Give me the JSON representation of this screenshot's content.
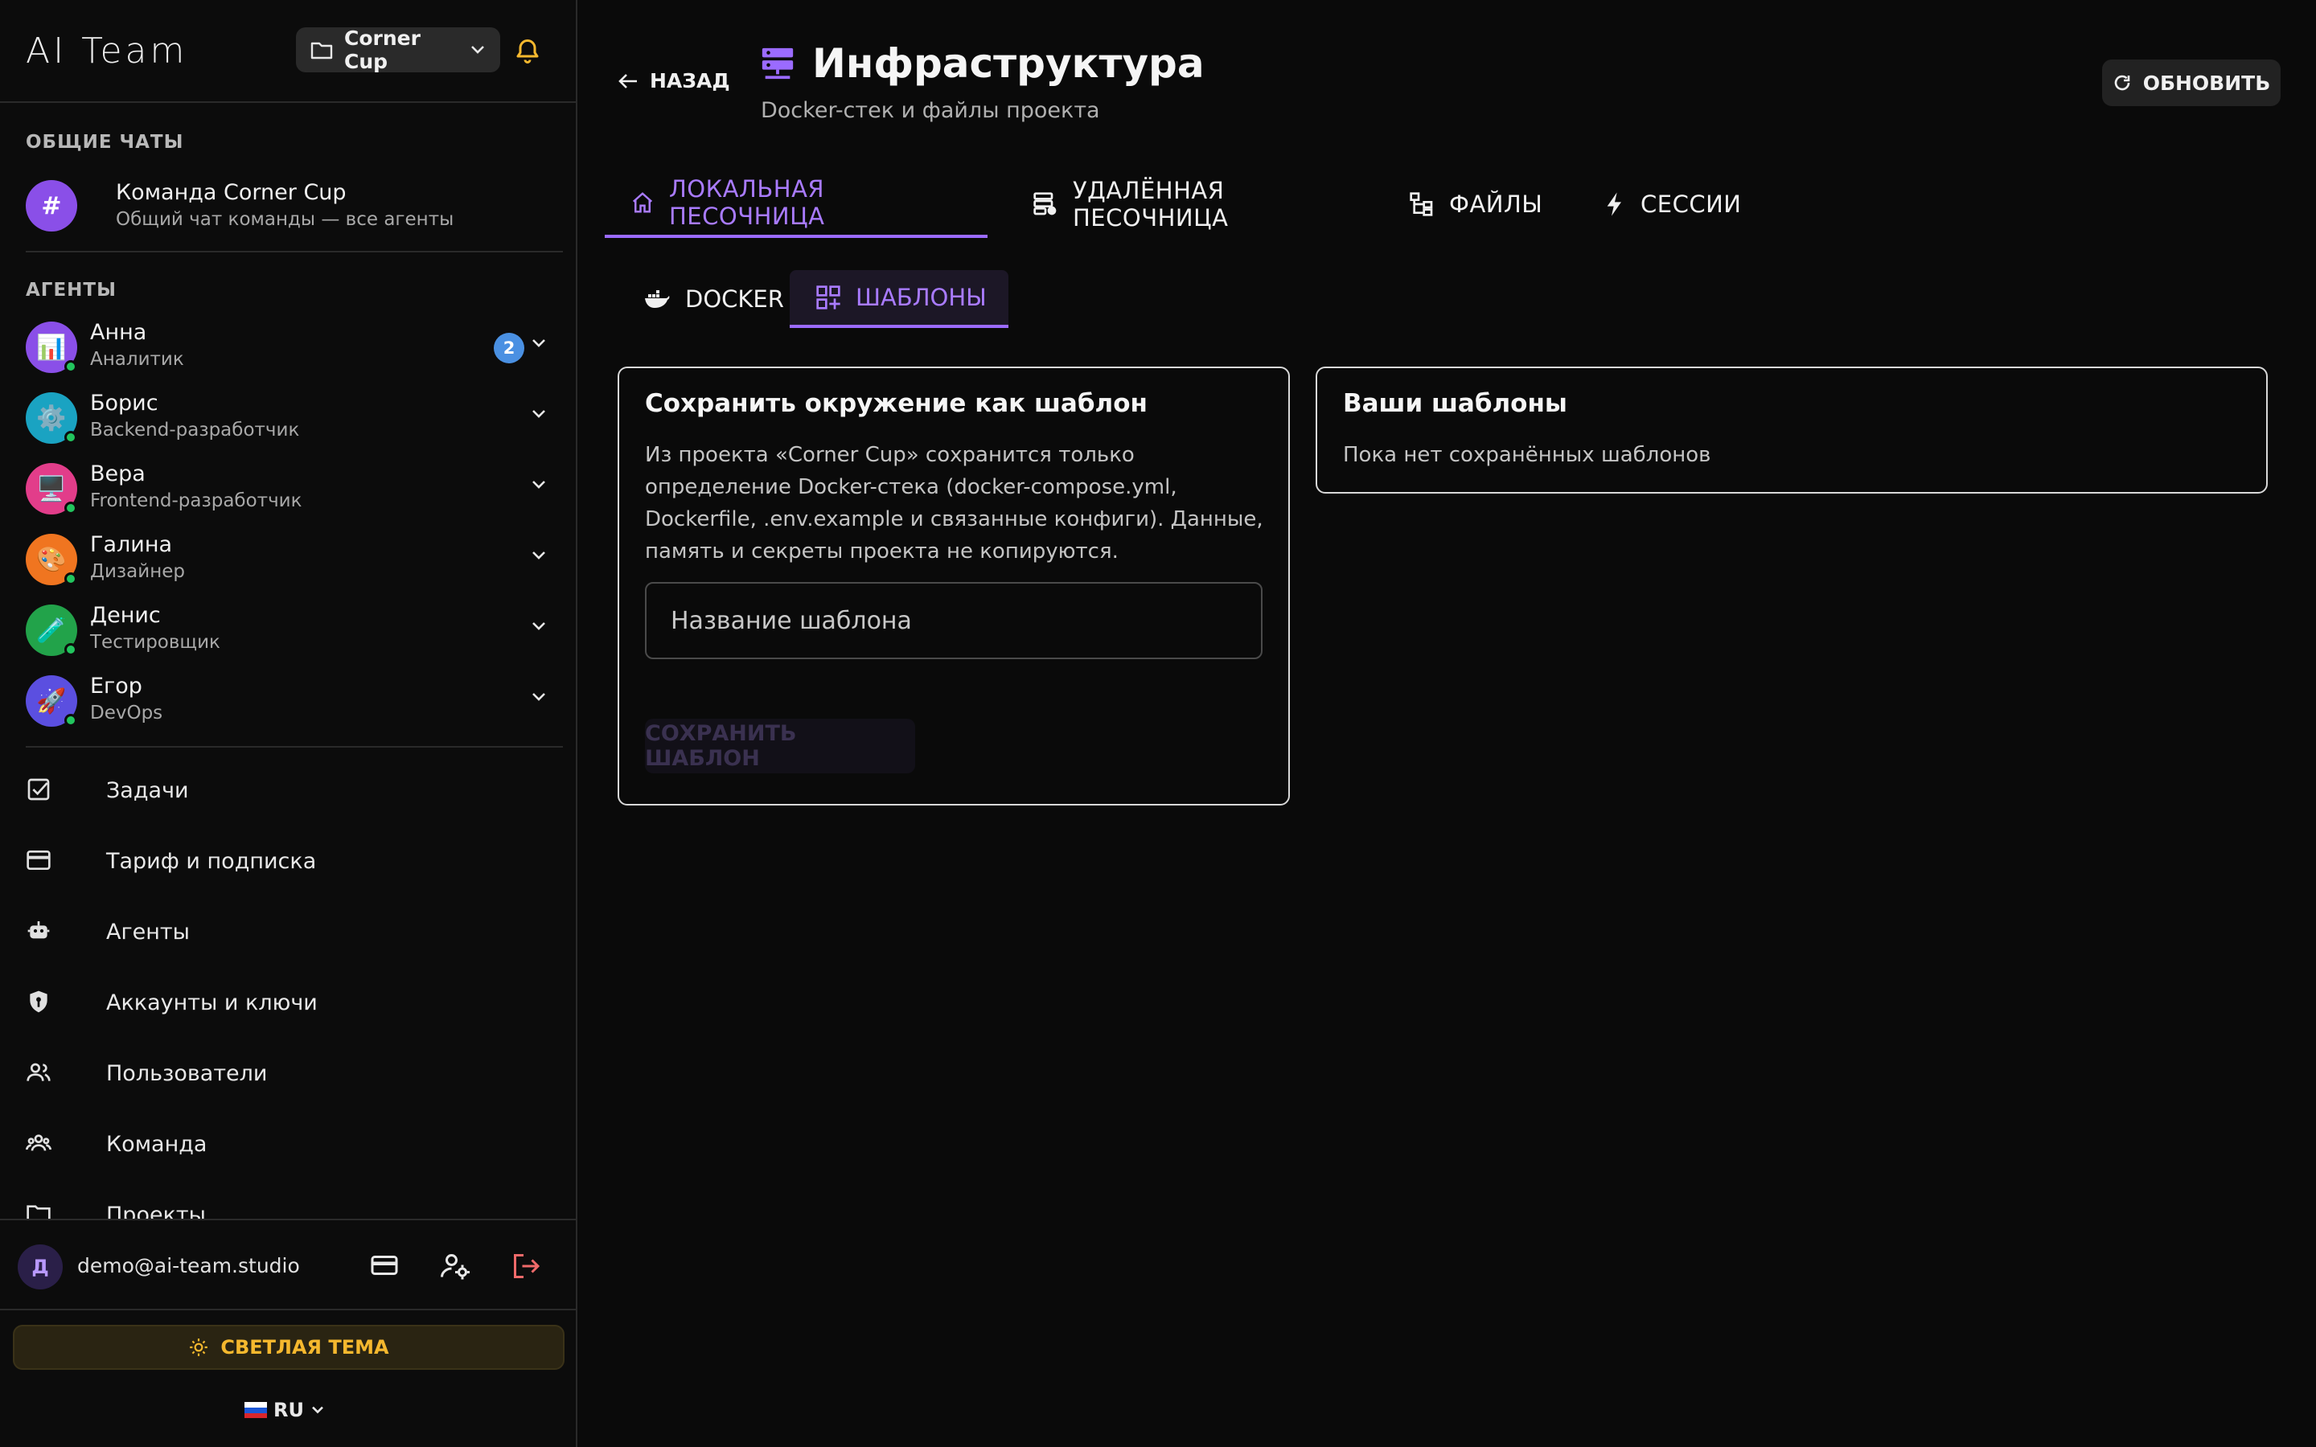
{
  "sidebar": {
    "app_title": "AI Team",
    "project_select": {
      "label": "Corner Cup"
    },
    "general_chats_title": "ОБЩИЕ ЧАТЫ",
    "team_chat": {
      "avatar": "#",
      "name": "Команда Corner Cup",
      "subtitle": "Общий чат команды — все агенты"
    },
    "agents_title": "АГЕНТЫ",
    "agents": [
      {
        "name": "Анна",
        "role": "Аналитик",
        "emoji": "📊",
        "color": "#8a4fe8",
        "badge": "2",
        "online": true
      },
      {
        "name": "Борис",
        "role": "Backend-разработчик",
        "emoji": "⚙️",
        "color": "#1aa3c2",
        "badge": "",
        "online": true
      },
      {
        "name": "Вера",
        "role": "Frontend-разработчик",
        "emoji": "🖥️",
        "color": "#e23d8a",
        "badge": "",
        "online": true
      },
      {
        "name": "Галина",
        "role": "Дизайнер",
        "emoji": "🎨",
        "color": "#f07520",
        "badge": "",
        "online": true
      },
      {
        "name": "Денис",
        "role": "Тестировщик",
        "emoji": "🧪",
        "color": "#22a34a",
        "badge": "",
        "online": true
      },
      {
        "name": "Егор",
        "role": "DevOps",
        "emoji": "🚀",
        "color": "#5b4fe0",
        "badge": "",
        "online": true
      }
    ],
    "nav": [
      {
        "label": "Задачи",
        "icon": "task-check-icon"
      },
      {
        "label": "Тариф и подписка",
        "icon": "credit-card-icon"
      },
      {
        "label": "Агенты",
        "icon": "robot-icon"
      },
      {
        "label": "Аккаунты и ключи",
        "icon": "shield-key-icon"
      },
      {
        "label": "Пользователи",
        "icon": "users-icon"
      },
      {
        "label": "Команда",
        "icon": "team-icon"
      },
      {
        "label": "Проекты",
        "icon": "folder-icon"
      }
    ],
    "user": {
      "initial": "Д",
      "email": "demo@ai-team.studio"
    },
    "theme_button": "СВЕТЛАЯ ТЕМА",
    "language": {
      "flag": "🇷🇺",
      "code": "RU"
    }
  },
  "header": {
    "back_label": "НАЗАД",
    "title": "Инфраструктура",
    "subtitle": "Docker-стек и файлы проекта",
    "refresh_label": "ОБНОВИТЬ"
  },
  "tabs": [
    {
      "label": "ЛОКАЛЬНАЯ ПЕСОЧНИЦА",
      "icon": "home-icon",
      "active": true
    },
    {
      "label": "УДАЛЁННАЯ ПЕСОЧНИЦА",
      "icon": "server-remote-icon",
      "active": false
    },
    {
      "label": "ФАЙЛЫ",
      "icon": "file-tree-icon",
      "active": false
    },
    {
      "label": "СЕССИИ",
      "icon": "bolt-icon",
      "active": false
    }
  ],
  "subtabs": [
    {
      "label": "DOCKER",
      "icon": "docker-icon",
      "active": false
    },
    {
      "label": "ШАБЛОНЫ",
      "icon": "templates-icon",
      "active": true
    }
  ],
  "save_card": {
    "title": "Сохранить окружение как шаблон",
    "description": "Из проекта «Corner Cup» сохранится только определение Docker-стека (docker-compose.yml, Dockerfile, .env.example и связанные конфиги). Данные, память и секреты проекта не копируются.",
    "input_placeholder": "Название шаблона",
    "input_value": "",
    "save_label": "СОХРАНИТЬ ШАБЛОН"
  },
  "templates_card": {
    "title": "Ваши шаблоны",
    "empty_text": "Пока нет сохранённых шаблонов"
  },
  "colors": {
    "accent": "#9b6bff",
    "warning": "#f5b82e",
    "badge": "#4a90e2",
    "online": "#22c55e",
    "logout": "#f06a6a"
  }
}
